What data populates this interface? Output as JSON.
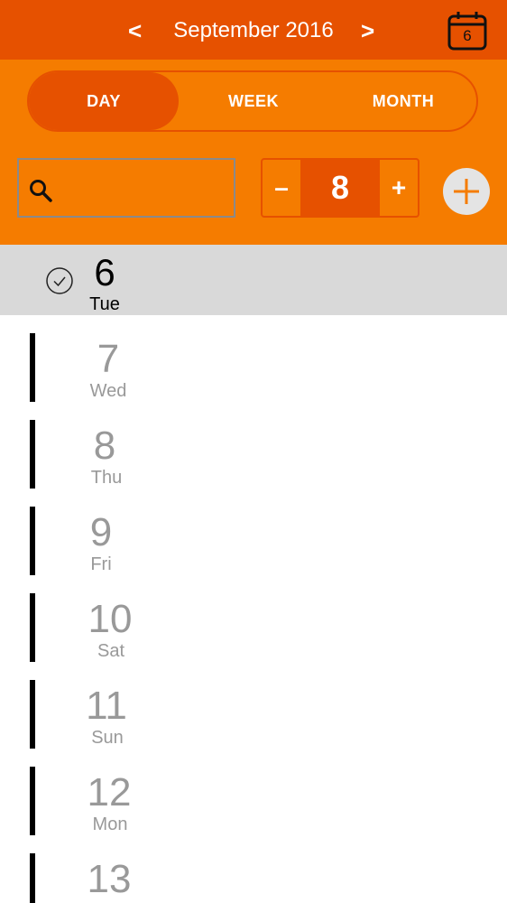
{
  "header": {
    "prev_label": "<",
    "month_title": "September 2016",
    "next_label": ">",
    "calendar_icon_day": "6"
  },
  "view_tabs": [
    {
      "label": "DAY",
      "selected": true
    },
    {
      "label": "WEEK",
      "selected": false
    },
    {
      "label": "MONTH",
      "selected": false
    }
  ],
  "search": {
    "placeholder": "",
    "value": ""
  },
  "stepper": {
    "minus_label": "–",
    "value": "8",
    "plus_label": "+"
  },
  "days": [
    {
      "num": "6",
      "name": "Tue",
      "selected": true
    },
    {
      "num": "7",
      "name": "Wed"
    },
    {
      "num": "8",
      "name": "Thu"
    },
    {
      "num": "9",
      "name": "Fri"
    },
    {
      "num": "10",
      "name": "Sat"
    },
    {
      "num": "11",
      "name": "Sun"
    },
    {
      "num": "12",
      "name": "Mon"
    },
    {
      "num": "13",
      "name": ""
    }
  ],
  "colors": {
    "topbar": "#e65100",
    "controls_bg": "#f57c00",
    "accent_dark": "#e65100",
    "selected_row": "#d9d9d9",
    "muted_text": "#999999"
  },
  "icons": [
    "calendar-icon",
    "search-icon",
    "plus-icon",
    "check-circle-icon"
  ]
}
